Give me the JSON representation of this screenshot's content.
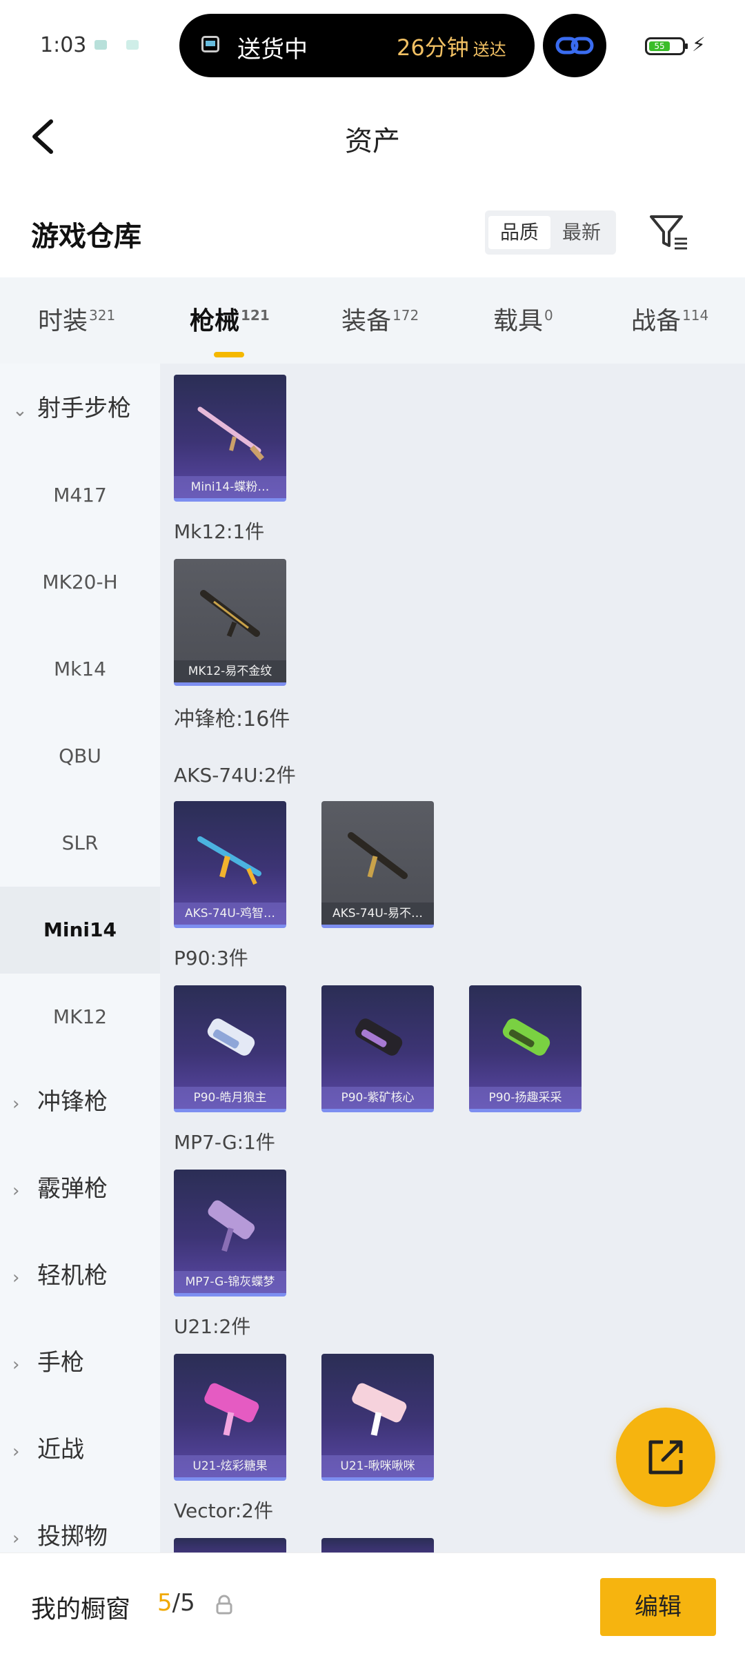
{
  "status_bar": {
    "time": "1:03",
    "island_text": "送货中",
    "island_eta": "26分钟",
    "island_eta_suffix": "送达",
    "battery": "55"
  },
  "header": {
    "title": "资产"
  },
  "warehouse": {
    "title": "游戏仓库",
    "sort_options": [
      "品质",
      "最新"
    ]
  },
  "tabs": [
    {
      "label": "时装",
      "count": "321"
    },
    {
      "label": "枪械",
      "count": "121"
    },
    {
      "label": "装备",
      "count": "172"
    },
    {
      "label": "载具",
      "count": "0"
    },
    {
      "label": "战备",
      "count": "114"
    }
  ],
  "sidebar": {
    "category_open": "射手步枪",
    "subitems": [
      "M417",
      "MK20-H",
      "Mk14",
      "QBU",
      "SLR",
      "Mini14",
      "MK12"
    ],
    "categories": [
      "冲锋枪",
      "霰弹枪",
      "轻机枪",
      "手枪",
      "近战",
      "投掷物"
    ]
  },
  "content": {
    "labels": {
      "mk12": "Mk12:1件",
      "smg": "冲锋枪:16件",
      "aks": "AKS-74U:2件",
      "p90": "P90:3件",
      "mp7": "MP7-G:1件",
      "u21": "U21:2件",
      "vector": "Vector:2件"
    },
    "cards": {
      "mini14": "Mini14-蝶粉…",
      "mk12": "MK12-易不金纹",
      "aks1": "AKS-74U-鸡智…",
      "aks2": "AKS-74U-易不…",
      "p90_1": "P90-皓月狼主",
      "p90_2": "P90-紫矿核心",
      "p90_3": "P90-扬趣采采",
      "mp7": "MP7-G-锦灰蝶梦",
      "u21_1": "U21-炫彩糖果",
      "u21_2": "U21-啾咪啾咪"
    }
  },
  "bottom_bar": {
    "label": "我的橱窗",
    "count_current": "5",
    "count_total": "/5",
    "edit": "编辑"
  },
  "colors": {
    "accent": "#f6b40f",
    "card_purple": "#3d3475",
    "card_gray": "#4c4e55"
  }
}
